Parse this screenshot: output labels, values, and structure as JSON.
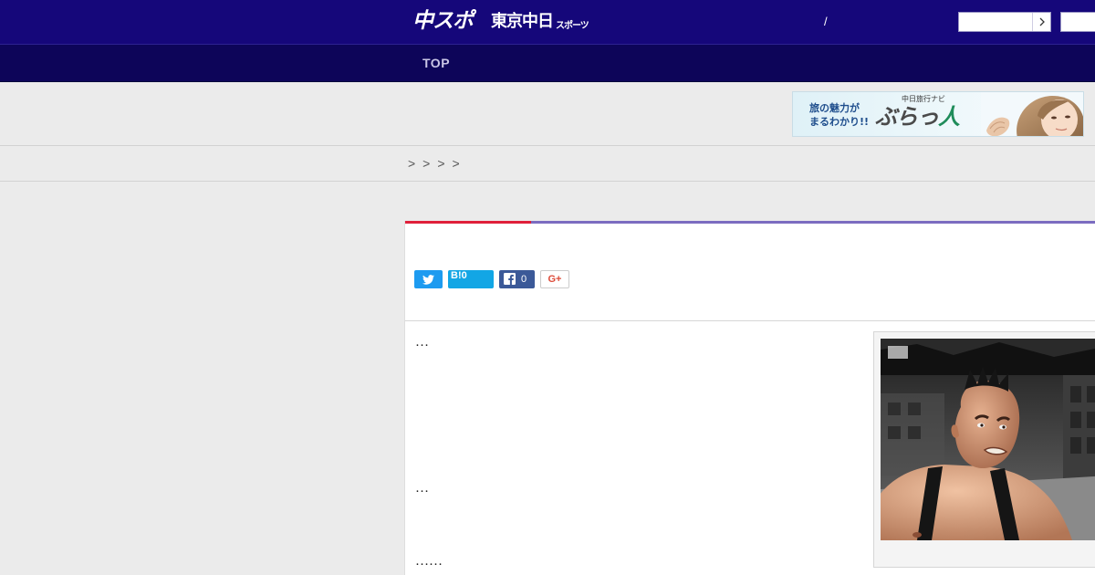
{
  "header": {
    "logo_main": "中スポ",
    "logo_sub": "東京中日",
    "logo_sub_small": "スポーツ",
    "separator": "/",
    "search_placeholder": "",
    "search_icon": "chevron-right-icon"
  },
  "nav": {
    "items": [
      "TOP"
    ]
  },
  "ad": {
    "text_left": "旅の魅力が まるわかり!!",
    "brand_small": "中日旅行ナビ",
    "brand": "ぶらっ",
    "brand_accent": "人"
  },
  "breadcrumb": {
    "separators": ">>>>"
  },
  "share": {
    "twitter_icon": "twitter-icon",
    "hatena_label": "B!0",
    "facebook_count": "0",
    "google_plus_label": "G+"
  },
  "article": {
    "paragraphs": [
      "…",
      "…",
      "……"
    ]
  },
  "colors": {
    "header_bg": "#15077a",
    "nav_bg": "#0d0559",
    "accent_red": "#e0203a",
    "accent_purple": "#7b6cc0",
    "twitter": "#1d9bf0",
    "hatena": "#12a6e5",
    "facebook": "#3b5998"
  }
}
